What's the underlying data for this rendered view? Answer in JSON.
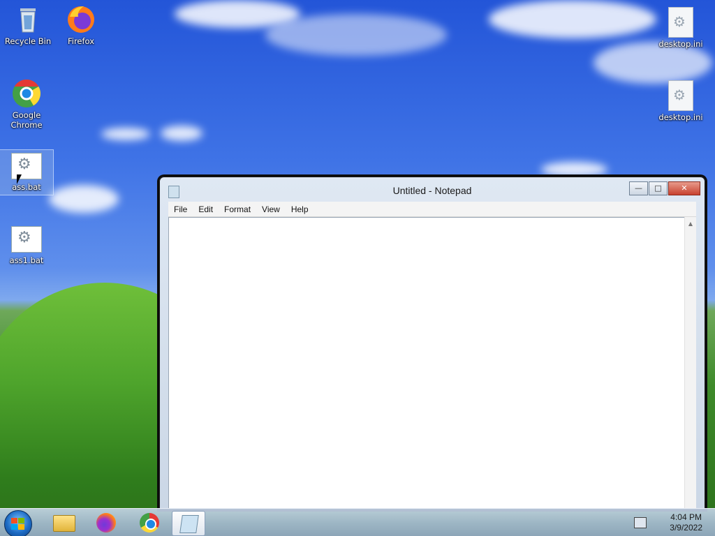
{
  "desktop": {
    "icons": [
      {
        "label": "Recycle Bin"
      },
      {
        "label": "Firefox"
      },
      {
        "label": "Google Chrome"
      },
      {
        "label": "ass.bat"
      },
      {
        "label": "ass1.bat"
      },
      {
        "label": "desktop.ini"
      },
      {
        "label": "desktop.ini"
      }
    ]
  },
  "notepad": {
    "title": "Untitled - Notepad",
    "menu": [
      "File",
      "Edit",
      "Format",
      "View",
      "Help"
    ],
    "content": ""
  },
  "taskbar": {
    "time": "4:04 PM",
    "date": "3/9/2022"
  },
  "icons": {
    "start": "windows-logo-icon",
    "folder": "file-explorer-icon",
    "firefox": "firefox-icon",
    "chrome": "chrome-icon",
    "notepad": "notepad-icon"
  }
}
